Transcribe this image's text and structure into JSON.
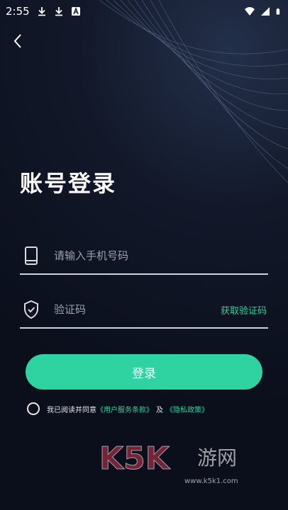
{
  "status_bar": {
    "time": "2:55",
    "icons": [
      "download-icon",
      "download-icon",
      "app-badge-icon",
      "wifi-icon",
      "signal-icon",
      "battery-icon"
    ]
  },
  "header": {
    "back_icon": "chevron-left-icon"
  },
  "page": {
    "title": "账号登录"
  },
  "form": {
    "phone_placeholder": "请输入手机号码",
    "phone_icon": "phone-icon",
    "code_placeholder": "验证码",
    "code_icon": "shield-check-icon",
    "get_code_label": "获取验证码",
    "login_label": "登录"
  },
  "agreement": {
    "prefix": "我已阅读并同意",
    "user_terms": "《用户服务条款》",
    "and": "及",
    "privacy_policy": "《隐私政策》"
  },
  "watermark": {
    "logo": "K5K",
    "text": "游网",
    "url": "www.k5k1.com"
  },
  "colors": {
    "accent": "#2ed3a1",
    "background": "#121829"
  }
}
